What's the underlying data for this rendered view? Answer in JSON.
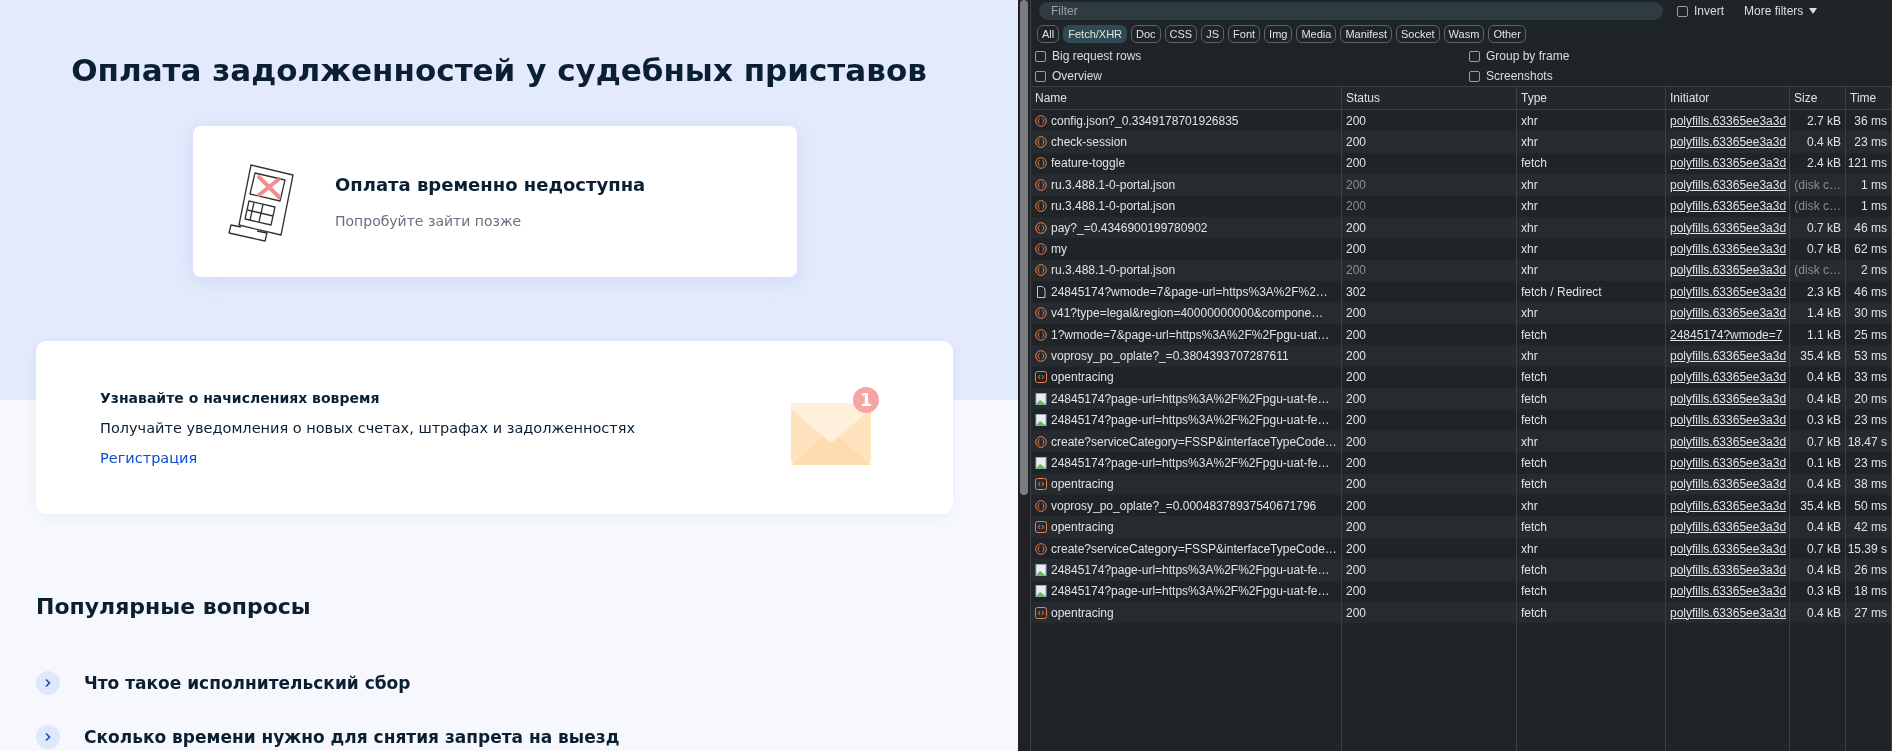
{
  "page": {
    "title": "Оплата задолженностей у судебных приставов",
    "status_card": {
      "title": "Оплата временно недоступна",
      "subtitle": "Попробуйте зайти позже"
    },
    "notify_card": {
      "title": "Узнавайте о начислениях вовремя",
      "text": "Получайте уведомления о новых счетах, штрафах и задолженностях",
      "link": "Регистрация",
      "badge": "1"
    },
    "faq": {
      "title": "Популярные вопросы",
      "items": [
        {
          "text": "Что такое исполнительский сбор"
        },
        {
          "text": "Сколько времени нужно для снятия запрета на выезд"
        }
      ]
    }
  },
  "devtools": {
    "filter": {
      "placeholder": "Filter"
    },
    "invert": {
      "label": "Invert",
      "checked": false
    },
    "more_filters": "More filters",
    "type_filters": [
      {
        "label": "All",
        "selected": false
      },
      {
        "label": "Fetch/XHR",
        "selected": true
      },
      {
        "label": "Doc",
        "selected": false
      },
      {
        "label": "CSS",
        "selected": false
      },
      {
        "label": "JS",
        "selected": false
      },
      {
        "label": "Font",
        "selected": false
      },
      {
        "label": "Img",
        "selected": false
      },
      {
        "label": "Media",
        "selected": false
      },
      {
        "label": "Manifest",
        "selected": false
      },
      {
        "label": "Socket",
        "selected": false
      },
      {
        "label": "Wasm",
        "selected": false
      },
      {
        "label": "Other",
        "selected": false
      }
    ],
    "options": [
      {
        "label": "Big request rows",
        "checked": false
      },
      {
        "label": "Group by frame",
        "checked": false
      },
      {
        "label": "Overview",
        "checked": false
      },
      {
        "label": "Screenshots",
        "checked": false
      }
    ],
    "columns": [
      "Name",
      "Status",
      "Type",
      "Initiator",
      "Size",
      "Time"
    ],
    "rows": [
      {
        "kind": "json",
        "name": "config.json?_0.3349178701926835",
        "status": "200",
        "dimmed": false,
        "type": "xhr",
        "initiator": "polyfills.63365ee3a3d",
        "size": "2.7 kB",
        "time": "36 ms"
      },
      {
        "kind": "json",
        "name": "check-session",
        "status": "200",
        "dimmed": false,
        "type": "xhr",
        "initiator": "polyfills.63365ee3a3d",
        "size": "0.4 kB",
        "time": "23 ms"
      },
      {
        "kind": "json",
        "name": "feature-toggle",
        "status": "200",
        "dimmed": false,
        "type": "fetch",
        "initiator": "polyfills.63365ee3a3d",
        "size": "2.4 kB",
        "time": "121 ms"
      },
      {
        "kind": "json",
        "name": "ru.3.488.1-0-portal.json",
        "status": "200",
        "dimmed": true,
        "type": "xhr",
        "initiator": "polyfills.63365ee3a3d",
        "size": "(disk c…",
        "time": "1 ms"
      },
      {
        "kind": "json",
        "name": "ru.3.488.1-0-portal.json",
        "status": "200",
        "dimmed": true,
        "type": "xhr",
        "initiator": "polyfills.63365ee3a3d",
        "size": "(disk c…",
        "time": "1 ms"
      },
      {
        "kind": "json",
        "name": "pay?_=0.4346900199780902",
        "status": "200",
        "dimmed": false,
        "type": "xhr",
        "initiator": "polyfills.63365ee3a3d",
        "size": "0.7 kB",
        "time": "46 ms"
      },
      {
        "kind": "json",
        "name": "my",
        "status": "200",
        "dimmed": false,
        "type": "xhr",
        "initiator": "polyfills.63365ee3a3d",
        "size": "0.7 kB",
        "time": "62 ms"
      },
      {
        "kind": "json",
        "name": "ru.3.488.1-0-portal.json",
        "status": "200",
        "dimmed": true,
        "type": "xhr",
        "initiator": "polyfills.63365ee3a3d",
        "size": "(disk c…",
        "time": "2 ms"
      },
      {
        "kind": "doc",
        "name": "24845174?wmode=7&page-url=https%3A%2F%2…",
        "status": "302",
        "dimmed": false,
        "type": "fetch / Redirect",
        "initiator": "polyfills.63365ee3a3d",
        "size": "2.3 kB",
        "time": "46 ms"
      },
      {
        "kind": "json",
        "name": "v41?type=legal&region=40000000000&compone…",
        "status": "200",
        "dimmed": false,
        "type": "xhr",
        "initiator": "polyfills.63365ee3a3d",
        "size": "1.4 kB",
        "time": "30 ms"
      },
      {
        "kind": "json",
        "name": "1?wmode=7&page-url=https%3A%2F%2Fpgu-uat…",
        "status": "200",
        "dimmed": false,
        "type": "fetch",
        "initiator": "24845174?wmode=7",
        "size": "1.1 kB",
        "time": "25 ms"
      },
      {
        "kind": "json",
        "name": "voprosy_po_oplate?_=0.3804393707287611",
        "status": "200",
        "dimmed": false,
        "type": "xhr",
        "initiator": "polyfills.63365ee3a3d",
        "size": "35.4 kB",
        "time": "53 ms"
      },
      {
        "kind": "trace",
        "name": "opentracing",
        "status": "200",
        "dimmed": false,
        "type": "fetch",
        "initiator": "polyfills.63365ee3a3d",
        "size": "0.4 kB",
        "time": "33 ms"
      },
      {
        "kind": "image",
        "name": "24845174?page-url=https%3A%2F%2Fpgu-uat-fe…",
        "status": "200",
        "dimmed": false,
        "type": "fetch",
        "initiator": "polyfills.63365ee3a3d",
        "size": "0.4 kB",
        "time": "20 ms"
      },
      {
        "kind": "image",
        "name": "24845174?page-url=https%3A%2F%2Fpgu-uat-fe…",
        "status": "200",
        "dimmed": false,
        "type": "fetch",
        "initiator": "polyfills.63365ee3a3d",
        "size": "0.3 kB",
        "time": "23 ms"
      },
      {
        "kind": "json",
        "name": "create?serviceCategory=FSSP&interfaceTypeCode…",
        "status": "200",
        "dimmed": false,
        "type": "xhr",
        "initiator": "polyfills.63365ee3a3d",
        "size": "0.7 kB",
        "time": "18.47 s"
      },
      {
        "kind": "image",
        "name": "24845174?page-url=https%3A%2F%2Fpgu-uat-fe…",
        "status": "200",
        "dimmed": false,
        "type": "fetch",
        "initiator": "polyfills.63365ee3a3d",
        "size": "0.1 kB",
        "time": "23 ms"
      },
      {
        "kind": "trace",
        "name": "opentracing",
        "status": "200",
        "dimmed": false,
        "type": "fetch",
        "initiator": "polyfills.63365ee3a3d",
        "size": "0.4 kB",
        "time": "38 ms"
      },
      {
        "kind": "json",
        "name": "voprosy_po_oplate?_=0.00048378937540671796",
        "status": "200",
        "dimmed": false,
        "type": "xhr",
        "initiator": "polyfills.63365ee3a3d",
        "size": "35.4 kB",
        "time": "50 ms"
      },
      {
        "kind": "trace",
        "name": "opentracing",
        "status": "200",
        "dimmed": false,
        "type": "fetch",
        "initiator": "polyfills.63365ee3a3d",
        "size": "0.4 kB",
        "time": "42 ms"
      },
      {
        "kind": "json",
        "name": "create?serviceCategory=FSSP&interfaceTypeCode…",
        "status": "200",
        "dimmed": false,
        "type": "xhr",
        "initiator": "polyfills.63365ee3a3d",
        "size": "0.7 kB",
        "time": "15.39 s"
      },
      {
        "kind": "image",
        "name": "24845174?page-url=https%3A%2F%2Fpgu-uat-fe…",
        "status": "200",
        "dimmed": false,
        "type": "fetch",
        "initiator": "polyfills.63365ee3a3d",
        "size": "0.4 kB",
        "time": "26 ms"
      },
      {
        "kind": "image",
        "name": "24845174?page-url=https%3A%2F%2Fpgu-uat-fe…",
        "status": "200",
        "dimmed": false,
        "type": "fetch",
        "initiator": "polyfills.63365ee3a3d",
        "size": "0.3 kB",
        "time": "18 ms"
      },
      {
        "kind": "trace",
        "name": "opentracing",
        "status": "200",
        "dimmed": false,
        "type": "fetch",
        "initiator": "polyfills.63365ee3a3d",
        "size": "0.4 kB",
        "time": "27 ms"
      }
    ]
  }
}
